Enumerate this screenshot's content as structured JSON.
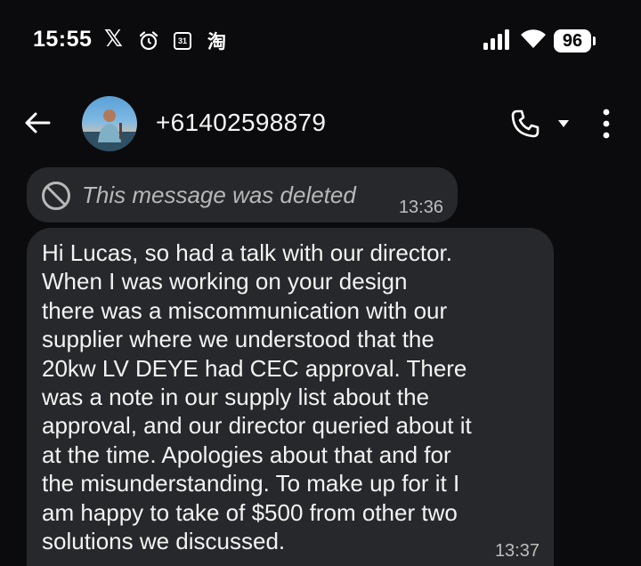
{
  "status_bar": {
    "time": "15:55",
    "x_glyph": "𝕏",
    "calendar_day": "31",
    "tao_glyph": "淘",
    "battery": "96",
    "icons": [
      "x-icon",
      "alarm-icon",
      "calendar-icon",
      "taobao-icon",
      "signal-icon",
      "wifi-icon",
      "battery-icon"
    ]
  },
  "header": {
    "contact": "+61402598879",
    "icons": [
      "back-arrow-icon",
      "avatar",
      "call-icon",
      "dropdown-icon",
      "more-vert-icon"
    ]
  },
  "messages": [
    {
      "type": "deleted",
      "text": "This message was deleted",
      "time": "13:36",
      "icon": "no-entry-icon"
    },
    {
      "type": "incoming",
      "text": "Hi Lucas, so had a talk with our director.\nWhen I was working on your design\nthere was a miscommunication with our\nsupplier where we understood that the\n20kw LV DEYE had CEC approval. There\nwas a note in our supply list about the\napproval, and our director queried about it\nat the time. Apologies about that and for\nthe misunderstanding. To make up for it I\nam happy to take of $500 from other two\nsolutions we discussed.",
      "time": "13:37"
    }
  ],
  "colors": {
    "background": "#0b0b0d",
    "bubble": "#26282b",
    "text": "#f3f3f3",
    "muted": "#b8b8b8"
  }
}
